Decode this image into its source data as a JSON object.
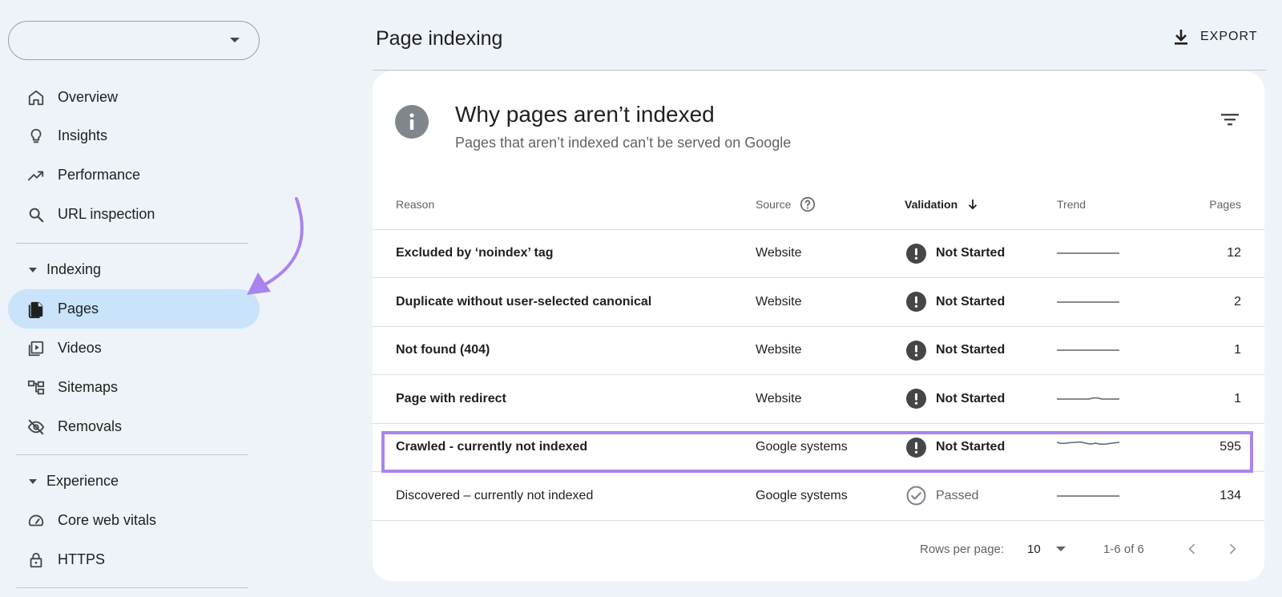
{
  "sidebar": {
    "property_value": "",
    "nav_top": [
      {
        "label": "Overview",
        "icon": "home-icon"
      },
      {
        "label": "Insights",
        "icon": "lightbulb-icon"
      },
      {
        "label": "Performance",
        "icon": "trending-up-icon"
      },
      {
        "label": "URL inspection",
        "icon": "search-icon"
      }
    ],
    "indexing": {
      "label": "Indexing",
      "items": [
        {
          "label": "Pages",
          "icon": "pages-icon",
          "active": true
        },
        {
          "label": "Videos",
          "icon": "video-library-icon"
        },
        {
          "label": "Sitemaps",
          "icon": "sitemap-icon"
        },
        {
          "label": "Removals",
          "icon": "visibility-off-icon"
        }
      ]
    },
    "experience": {
      "label": "Experience",
      "items": [
        {
          "label": "Core web vitals",
          "icon": "speed-gauge-icon"
        },
        {
          "label": "HTTPS",
          "icon": "lock-icon"
        }
      ]
    }
  },
  "header": {
    "title": "Page indexing",
    "export_label": "EXPORT"
  },
  "card": {
    "title": "Why pages aren’t indexed",
    "subtitle": "Pages that aren’t indexed can’t be served on Google"
  },
  "table": {
    "columns": {
      "reason": "Reason",
      "source": "Source",
      "validation": "Validation",
      "trend": "Trend",
      "pages": "Pages"
    },
    "rows": [
      {
        "reason": "Excluded by ‘noindex’ tag",
        "source": "Website",
        "validation": "Not Started",
        "pages": "12"
      },
      {
        "reason": "Duplicate without user-selected canonical",
        "source": "Website",
        "validation": "Not Started",
        "pages": "2"
      },
      {
        "reason": "Not found (404)",
        "source": "Website",
        "validation": "Not Started",
        "pages": "1"
      },
      {
        "reason": "Page with redirect",
        "source": "Website",
        "validation": "Not Started",
        "pages": "1"
      },
      {
        "reason": "Crawled - currently not indexed",
        "source": "Google systems",
        "validation": "Not Started",
        "pages": "595"
      },
      {
        "reason": "Discovered – currently not indexed",
        "source": "Google systems",
        "validation": "Passed",
        "pages": "134"
      }
    ]
  },
  "pagination": {
    "rows_per_page_label": "Rows per page:",
    "rows_per_page_value": "10",
    "range": "1-6 of 6"
  },
  "colors": {
    "accent_highlight": "#a984ee",
    "active_nav": "#c9e3fb",
    "background": "#eef2f9",
    "status_icon": "#444746"
  }
}
